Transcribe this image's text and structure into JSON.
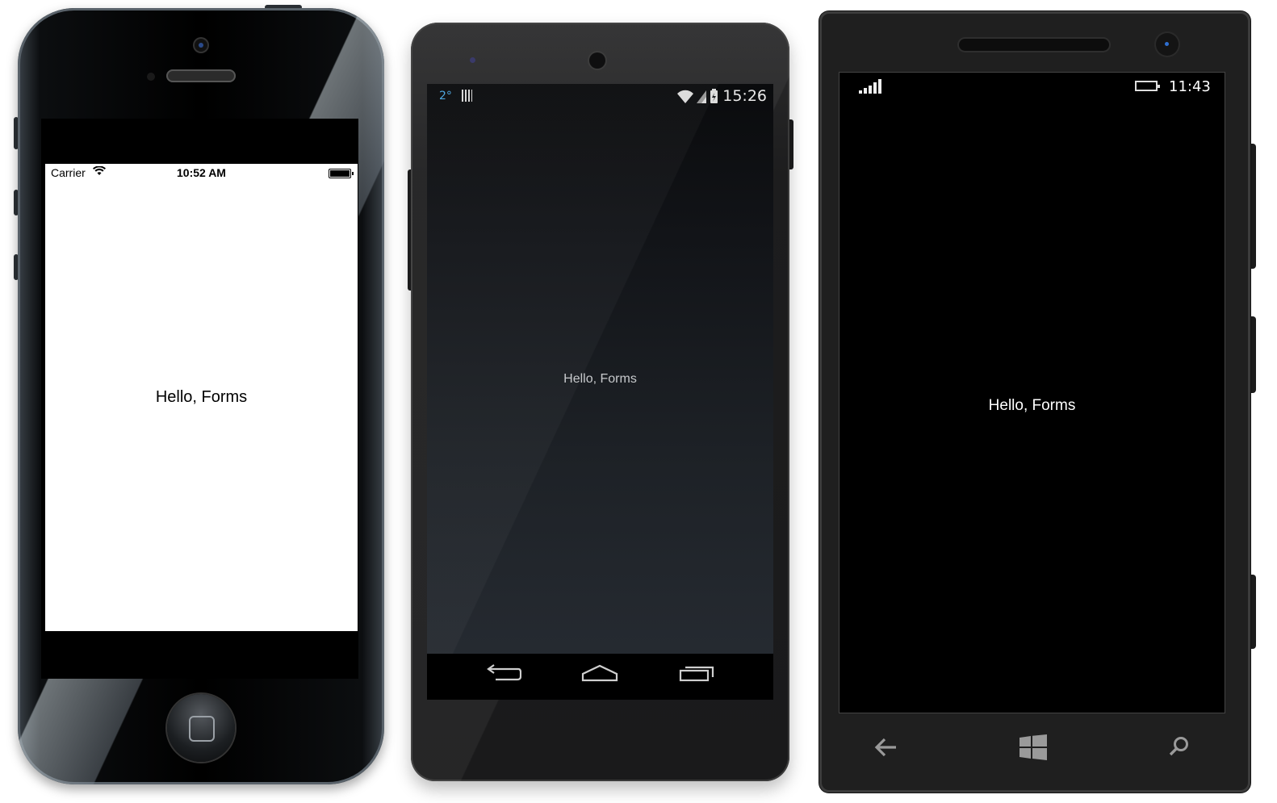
{
  "iphone": {
    "status": {
      "carrier": "Carrier",
      "time": "10:52 AM",
      "wifi_icon": "wifi-icon",
      "battery_icon": "battery-icon"
    },
    "label": "Hello, Forms",
    "background": "#ffffff",
    "text_color": "#000000"
  },
  "android": {
    "status": {
      "notification": "2°",
      "time": "15:26",
      "icons_text": "▼◢▮"
    },
    "label": "Hello, Forms",
    "nav": {
      "back": "⮌",
      "home": "⌂",
      "recents": "❐"
    },
    "text_color": "#c7c9cc"
  },
  "windows_phone": {
    "status": {
      "time": "11:43"
    },
    "label": "Hello, Forms",
    "nav": {
      "back": "←",
      "start": "⊞",
      "search": "⚲"
    },
    "background": "#000000",
    "text_color": "#ffffff"
  }
}
